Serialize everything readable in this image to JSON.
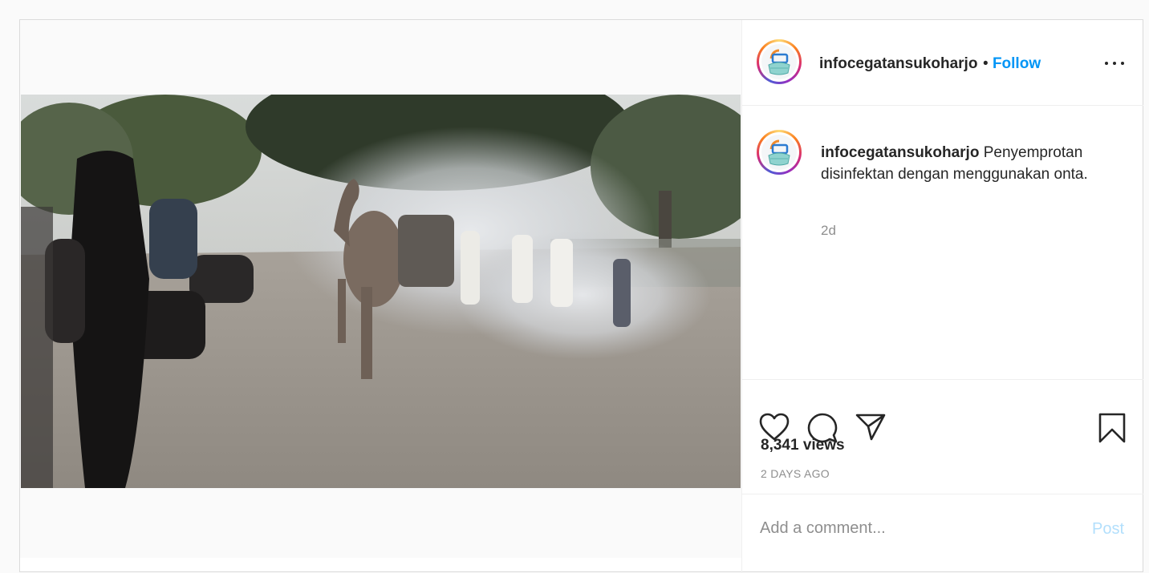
{
  "post": {
    "author": {
      "username": "infocegatansukoharjo",
      "follow_label": "Follow",
      "separator": "•"
    },
    "caption": {
      "username": "infocegatansukoharjo",
      "text": "Penyemprotan disinfektan dengan menggunakan onta.",
      "age": "2d"
    },
    "stats": {
      "views": "8,341 views",
      "time_ago": "2 DAYS AGO"
    },
    "comment": {
      "placeholder": "Add a comment...",
      "post_label": "Post"
    },
    "icons": {
      "like": "heart-icon",
      "comment": "comment-bubble-icon",
      "share": "paper-plane-icon",
      "save": "bookmark-icon",
      "more": "more-options-icon",
      "avatar_logo": "ics-mask-logo"
    },
    "colors": {
      "follow": "#0095f6",
      "post_disabled": "#b2dffc",
      "muted": "#8e8e8e",
      "text": "#262626"
    }
  }
}
